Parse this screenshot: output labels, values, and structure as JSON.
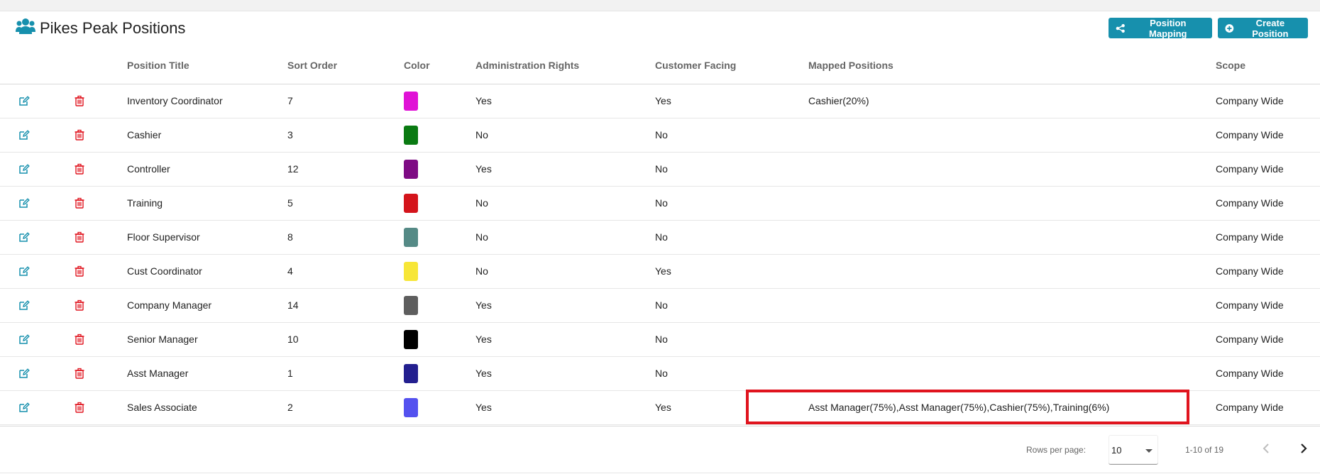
{
  "header": {
    "title": "Pikes Peak Positions",
    "title_icon": "users-icon",
    "buttons": {
      "position_mapping": "Position Mapping",
      "create_position": "Create Position"
    }
  },
  "table": {
    "columns": {
      "position_title": "Position Title",
      "sort_order": "Sort Order",
      "color": "Color",
      "admin_rights": "Administration Rights",
      "customer_facing": "Customer Facing",
      "mapped_positions": "Mapped Positions",
      "scope": "Scope"
    },
    "rows": [
      {
        "title": "Inventory Coordinator",
        "sort": "7",
        "color": "#e012d6",
        "admin": "Yes",
        "customer": "Yes",
        "mapped": "Cashier(20%)",
        "scope": "Company Wide"
      },
      {
        "title": "Cashier",
        "sort": "3",
        "color": "#0a7a12",
        "admin": "No",
        "customer": "No",
        "mapped": "",
        "scope": "Company Wide"
      },
      {
        "title": "Controller",
        "sort": "12",
        "color": "#7e0b84",
        "admin": "Yes",
        "customer": "No",
        "mapped": "",
        "scope": "Company Wide"
      },
      {
        "title": "Training",
        "sort": "5",
        "color": "#d4141b",
        "admin": "No",
        "customer": "No",
        "mapped": "",
        "scope": "Company Wide"
      },
      {
        "title": "Floor Supervisor",
        "sort": "8",
        "color": "#558a86",
        "admin": "No",
        "customer": "No",
        "mapped": "",
        "scope": "Company Wide"
      },
      {
        "title": "Cust Coordinator",
        "sort": "4",
        "color": "#f7e637",
        "admin": "No",
        "customer": "Yes",
        "mapped": "",
        "scope": "Company Wide"
      },
      {
        "title": "Company Manager",
        "sort": "14",
        "color": "#5e5e5e",
        "admin": "Yes",
        "customer": "No",
        "mapped": "",
        "scope": "Company Wide"
      },
      {
        "title": "Senior Manager",
        "sort": "10",
        "color": "#000000",
        "admin": "Yes",
        "customer": "No",
        "mapped": "",
        "scope": "Company Wide"
      },
      {
        "title": "Asst Manager",
        "sort": "1",
        "color": "#231f8f",
        "admin": "Yes",
        "customer": "No",
        "mapped": "",
        "scope": "Company Wide"
      },
      {
        "title": "Sales Associate",
        "sort": "2",
        "color": "#5451ef",
        "admin": "Yes",
        "customer": "Yes",
        "mapped": "Asst Manager(75%),Asst Manager(75%),Cashier(75%),Training(6%)",
        "scope": "Company Wide"
      }
    ]
  },
  "pagination": {
    "rows_per_page_label": "Rows per page:",
    "rows_per_page_value": "10",
    "range": "1-10 of 19"
  },
  "colors": {
    "accent": "#1790ad",
    "edit_icon": "#1790ad",
    "delete_icon": "#e0141e",
    "highlight": "#e0141e"
  }
}
